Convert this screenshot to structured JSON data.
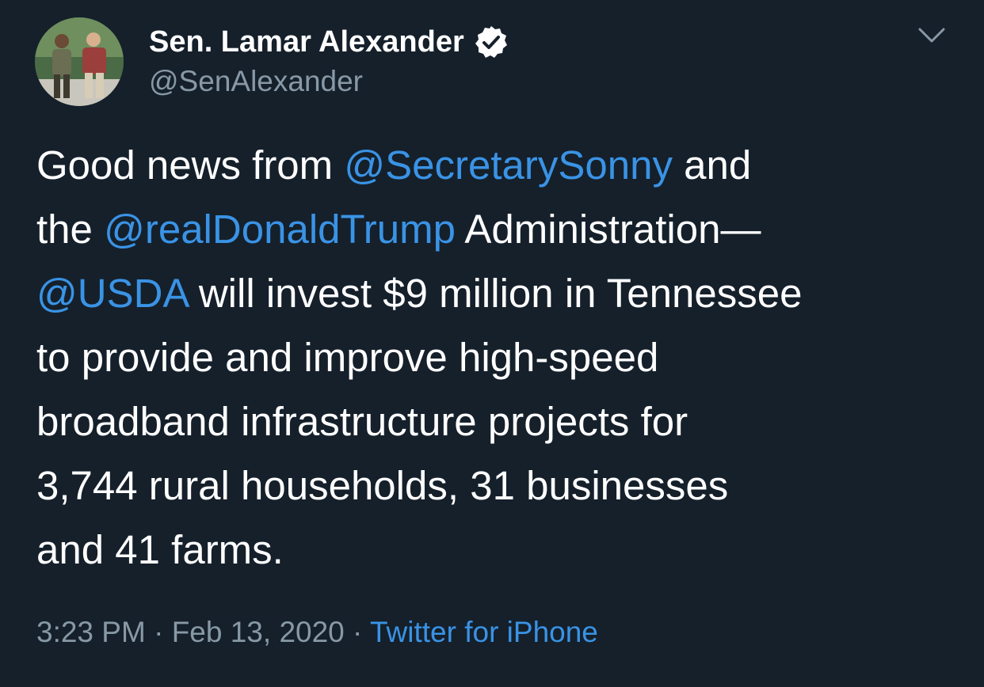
{
  "author": {
    "display_name": "Sen. Lamar Alexander",
    "handle": "@SenAlexander",
    "verified": true
  },
  "menu_icon": "chevron-down-icon",
  "tweet": {
    "lines": [
      [
        {
          "t": "Good news from "
        },
        {
          "t": "@SecretarySonny",
          "m": true
        },
        {
          "t": " and"
        }
      ],
      [
        {
          "t": "the "
        },
        {
          "t": "@realDonaldTrump",
          "m": true
        },
        {
          "t": " Administration—"
        }
      ],
      [
        {
          "t": "@USDA",
          "m": true
        },
        {
          "t": " will invest $9 million in Tennessee"
        }
      ],
      [
        {
          "t": "to provide and improve high-speed"
        }
      ],
      [
        {
          "t": "broadband infrastructure projects for"
        }
      ],
      [
        {
          "t": "3,744 rural households, 31 businesses"
        }
      ],
      [
        {
          "t": "and 41 farms."
        }
      ]
    ]
  },
  "meta": {
    "time": "3:23 PM",
    "separator": " · ",
    "date": "Feb 13, 2020",
    "separator2": " · ",
    "source": "Twitter for iPhone"
  },
  "colors": {
    "background": "#15202b",
    "text": "#ffffff",
    "secondary": "#8899a6",
    "link": "#3a93e5"
  }
}
